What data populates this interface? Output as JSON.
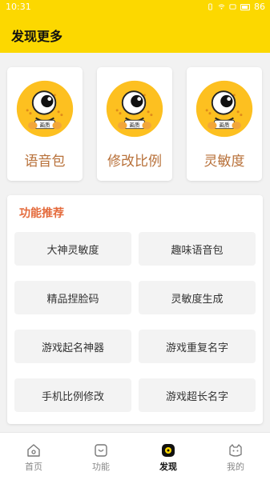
{
  "status_bar": {
    "time": "10:31",
    "battery": "86"
  },
  "header": {
    "title": "发现更多"
  },
  "cards": [
    {
      "label": "语音包"
    },
    {
      "label": "修改比例"
    },
    {
      "label": "灵敏度"
    }
  ],
  "mascot_badge": "画质",
  "recommend": {
    "title": "功能推荐",
    "items": [
      {
        "label": "大神灵敏度"
      },
      {
        "label": "趣味语音包"
      },
      {
        "label": "精品捏脸码"
      },
      {
        "label": "灵敏度生成"
      },
      {
        "label": "游戏起名神器"
      },
      {
        "label": "游戏重复名字"
      },
      {
        "label": "手机比例修改"
      },
      {
        "label": "游戏超长名字"
      }
    ]
  },
  "bottom_nav": {
    "tabs": [
      {
        "label": "首页",
        "icon": "home-icon"
      },
      {
        "label": "功能",
        "icon": "function-icon"
      },
      {
        "label": "发现",
        "icon": "discover-icon",
        "active": true
      },
      {
        "label": "我的",
        "icon": "cat-profile-icon"
      }
    ]
  },
  "colors": {
    "header_bg": "#fcd800",
    "card_label": "#b8713a",
    "section_title": "#e46a3b",
    "mascot_yellow": "#fdc020"
  }
}
